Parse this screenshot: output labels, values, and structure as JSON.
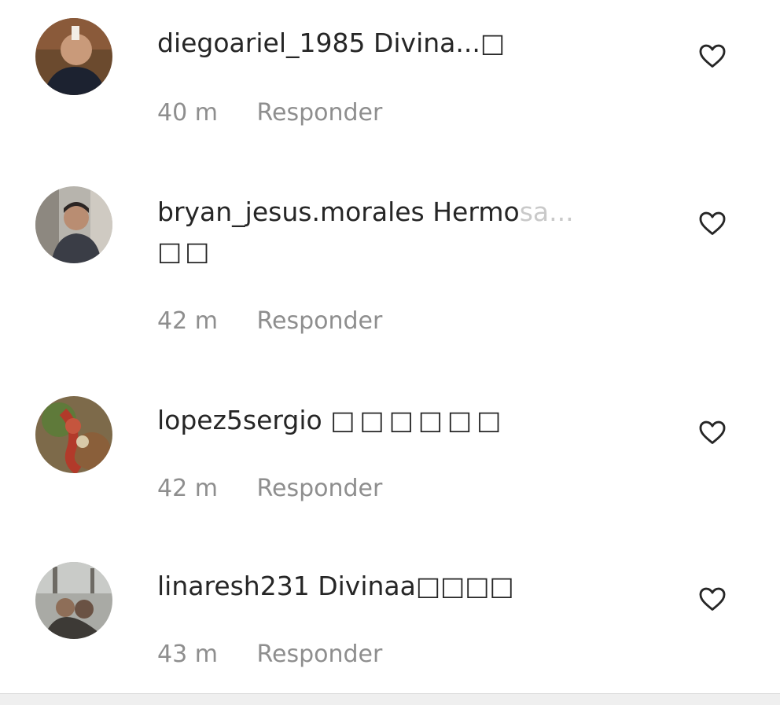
{
  "comments": [
    {
      "username": "diegoariel_1985",
      "text": "Divina...□",
      "text_line2": "",
      "fade_text": "",
      "time": "40 m",
      "reply_label": "Responder",
      "like_icon": "heart-outline-icon"
    },
    {
      "username": "bryan_jesus.morales",
      "text": "Hermo",
      "fade_text": "sa...",
      "text_line2": "□□",
      "time": "42 m",
      "reply_label": "Responder",
      "like_icon": "heart-outline-icon"
    },
    {
      "username": "lopez5sergio",
      "text": "□□□□□□",
      "text_line2": "",
      "fade_text": "",
      "time": "42 m",
      "reply_label": "Responder",
      "like_icon": "heart-outline-icon"
    },
    {
      "username": "linaresh231",
      "text": "Divinaa□□□□",
      "text_line2": "",
      "fade_text": "",
      "time": "43 m",
      "reply_label": "Responder",
      "like_icon": "heart-outline-icon"
    }
  ],
  "colors": {
    "primary_text": "#262626",
    "secondary_text": "#8e8e8e",
    "background": "#ffffff"
  }
}
